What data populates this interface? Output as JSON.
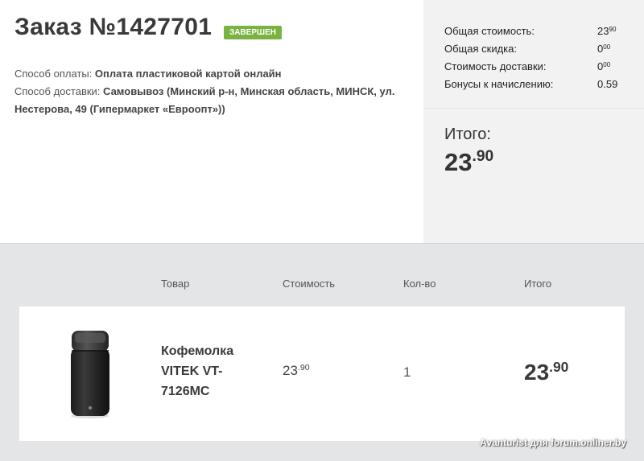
{
  "order": {
    "title": "Заказ №1427701",
    "status": "ЗАВЕРШЕН",
    "payment_label": "Способ оплаты: ",
    "payment_value": "Оплата пластиковой картой онлайн",
    "delivery_label": "Способ доставки: ",
    "delivery_value": "Самовывоз (Минский р-н, Минская область, МИНСК, ул. Нестерова, 49 (Гипермаркет «Евроопт»))"
  },
  "summary": {
    "rows": [
      {
        "label": "Общая стоимость:",
        "int": "23",
        "frac": "90"
      },
      {
        "label": "Общая скидка:",
        "int": "0",
        "frac": "00"
      },
      {
        "label": "Стоимость доставки:",
        "int": "0",
        "frac": "00"
      },
      {
        "label": "Бонусы к начислению:",
        "value": "0.59"
      }
    ],
    "total_label": "Итого:",
    "total_int": "23",
    "total_frac": ".90"
  },
  "table": {
    "headers": {
      "product": "Товар",
      "price": "Стоимость",
      "qty": "Кол-во",
      "total": "Итого"
    },
    "items": [
      {
        "name": "Кофемолка VITEK VT-7126MC",
        "price_int": "23",
        "price_frac": ".90",
        "qty": "1",
        "total_int": "23",
        "total_frac": ".90",
        "image": "coffee-grinder-photo"
      }
    ]
  },
  "watermark": "Avanturist для forum.onliner.by",
  "colors": {
    "status_badge": "#7bb343",
    "page_bg": "#e4e5e7",
    "summary_bg": "#f2f2f3"
  }
}
